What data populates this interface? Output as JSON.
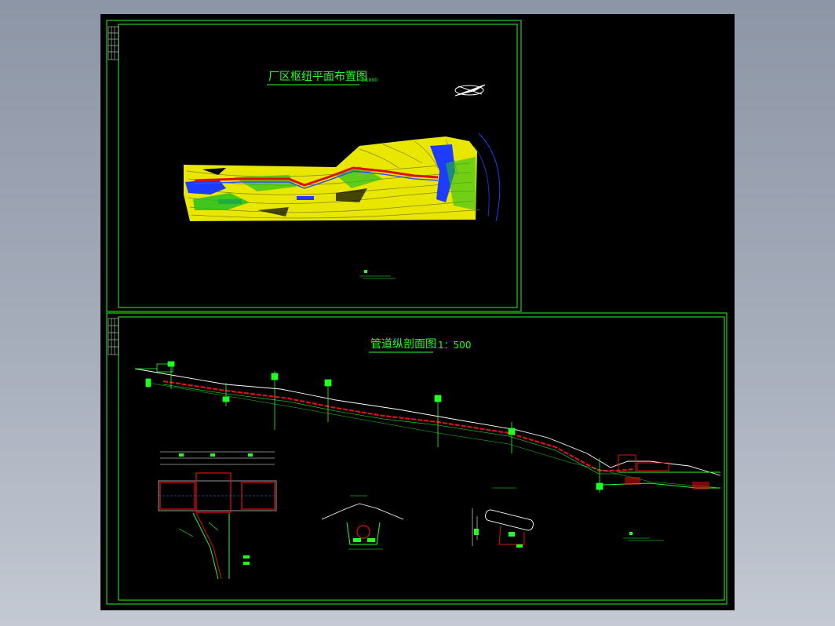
{
  "drawing": {
    "sheet1_title": "厂区枢纽平面布置图",
    "sheet1_scale": "1:1000",
    "sheet2_title": "管道纵剖面图",
    "sheet2_scale": "1：500"
  },
  "colors": {
    "frame": "#1fd21f",
    "background": "#000000",
    "pipe": "#e01010",
    "contour_yellow": "#f4f000",
    "water_blue": "#1e3cff",
    "annotation_green": "#22ff22",
    "ground_white": "#ffffff"
  }
}
